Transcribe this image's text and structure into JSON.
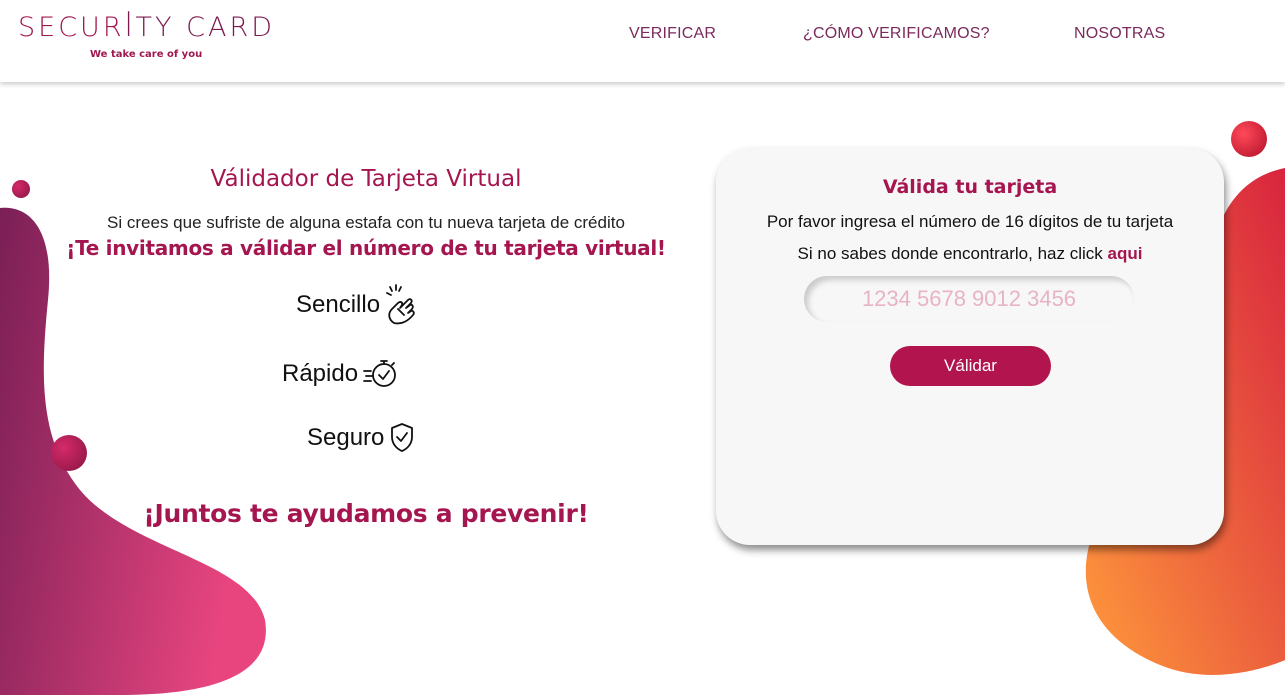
{
  "header": {
    "logo_text_a": "SECUR",
    "logo_text_b": "TY CARD",
    "logo_tagline": "We take care of you",
    "nav": [
      {
        "label": "VERIFICAR"
      },
      {
        "label": "¿CÓMO VERIFICAMOS?"
      },
      {
        "label": "NOSOTRAS"
      }
    ]
  },
  "hero": {
    "title": "Válidador de Tarjeta Virtual",
    "subtitle": "Si crees que sufriste de alguna estafa con tu nueva tarjeta de crédito",
    "invite": "¡Te invitamos a válidar el número de tu tarjeta virtual!",
    "features": [
      {
        "label": "Sencillo",
        "icon": "crossed-fingers-icon"
      },
      {
        "label": "Rápido",
        "icon": "stopwatch-icon"
      },
      {
        "label": "Seguro",
        "icon": "shield-check-icon"
      }
    ],
    "closing": "¡Juntos te ayudamos a prevenir!"
  },
  "card": {
    "title": "Válida tu tarjeta",
    "instructions": "Por favor ingresa el número de 16 dígitos de tu tarjeta",
    "help_text": "Si no sabes donde encontrarlo, haz click",
    "help_link": "aqui",
    "input_placeholder": "1234 5678 9012 3456",
    "input_value": "",
    "button_label": "Válidar"
  },
  "colors": {
    "brand": "#a5154f",
    "button": "#b2144e",
    "nav": "#7a2a5b",
    "blob_left_start": "#7a1f56",
    "blob_left_end": "#e8457f",
    "blob_right_start": "#ff9a3c",
    "blob_right_end": "#d8243e"
  }
}
